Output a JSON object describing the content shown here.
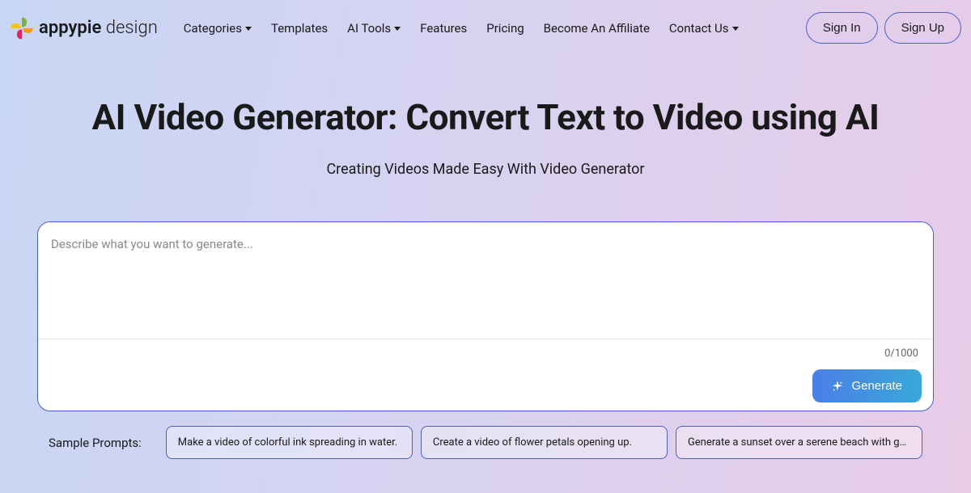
{
  "brand": {
    "name": "appypie",
    "suffix": "design"
  },
  "nav": {
    "categories": "Categories",
    "templates": "Templates",
    "ai_tools": "AI Tools",
    "features": "Features",
    "pricing": "Pricing",
    "affiliate": "Become An Affiliate",
    "contact": "Contact Us"
  },
  "auth": {
    "sign_in": "Sign In",
    "sign_up": "Sign Up"
  },
  "hero": {
    "title": "AI Video Generator: Convert Text to Video using AI",
    "subtitle": "Creating Videos Made Easy With Video Generator"
  },
  "prompt": {
    "placeholder": "Describe what you want to generate...",
    "char_count": "0/1000",
    "generate_label": "Generate"
  },
  "samples": {
    "label": "Sample Prompts:",
    "items": [
      "Make a video of colorful ink spreading in water.",
      "Create a video of flower petals opening up.",
      "Generate a sunset over a serene beach with g…"
    ]
  }
}
